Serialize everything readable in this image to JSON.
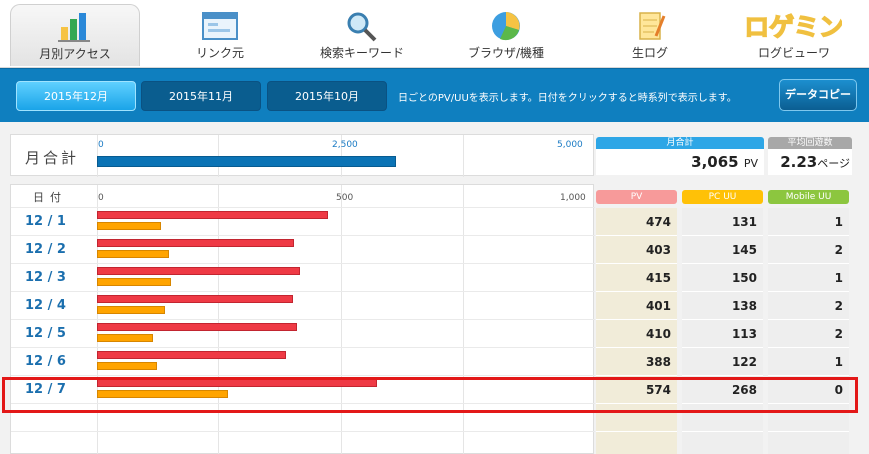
{
  "nav": [
    {
      "label": "月別アクセス",
      "icon": "bar-chart-icon",
      "active": true
    },
    {
      "label": "リンク元",
      "icon": "window-icon",
      "active": false
    },
    {
      "label": "検索キーワード",
      "icon": "magnifier-icon",
      "active": false
    },
    {
      "label": "ブラウザ/機種",
      "icon": "pie-chart-icon",
      "active": false
    },
    {
      "label": "生ログ",
      "icon": "pencil-note-icon",
      "active": false
    },
    {
      "label": "ログビューワ",
      "icon": "logo-icon",
      "active": false
    }
  ],
  "logo_text": "ロゲミン",
  "months": [
    "2015年12月",
    "2015年11月",
    "2015年10月"
  ],
  "tab_info": "日ごとのPV/UUを表示します。日付をクリックすると時系列で表示します。",
  "copy_button": "データコピー",
  "summary": {
    "label": "月合計",
    "axis": [
      "0",
      "2,500",
      "5,000"
    ],
    "bar_value": 3065,
    "bar_max": 5000
  },
  "stats": {
    "monthly_total": {
      "label": "月合計",
      "value": "3,065",
      "unit": "PV"
    },
    "avg_visits": {
      "label": "平均回遊数",
      "value": "2.23",
      "unit": "ページ"
    }
  },
  "daily": {
    "date_header": "日付",
    "axis": [
      "0",
      "500",
      "1,000"
    ],
    "axis_max": 1000,
    "col_pv": "PV",
    "col_pc": "PC UU",
    "col_mobile": "Mobile UU",
    "rows": [
      {
        "date": "12 / 1",
        "pv": "474",
        "pc": "131",
        "mobile": "1"
      },
      {
        "date": "12 / 2",
        "pv": "403",
        "pc": "145",
        "mobile": "2"
      },
      {
        "date": "12 / 3",
        "pv": "415",
        "pc": "150",
        "mobile": "1"
      },
      {
        "date": "12 / 4",
        "pv": "401",
        "pc": "138",
        "mobile": "2"
      },
      {
        "date": "12 / 5",
        "pv": "410",
        "pc": "113",
        "mobile": "2"
      },
      {
        "date": "12 / 6",
        "pv": "388",
        "pc": "122",
        "mobile": "1"
      },
      {
        "date": "12 / 7",
        "pv": "574",
        "pc": "268",
        "mobile": "0"
      }
    ]
  },
  "colors": {
    "tab_blue": "#0f7fbf",
    "pv_red": "#ef3a45",
    "uu_orange": "#ffa400",
    "pv_head": "#f79a9a",
    "pc_head": "#ffc107",
    "mobile_head": "#8cc63f",
    "stat_head_blue": "#2ea6e6",
    "stat_head_gray": "#a8a8a8",
    "highlight": "#e31818"
  }
}
